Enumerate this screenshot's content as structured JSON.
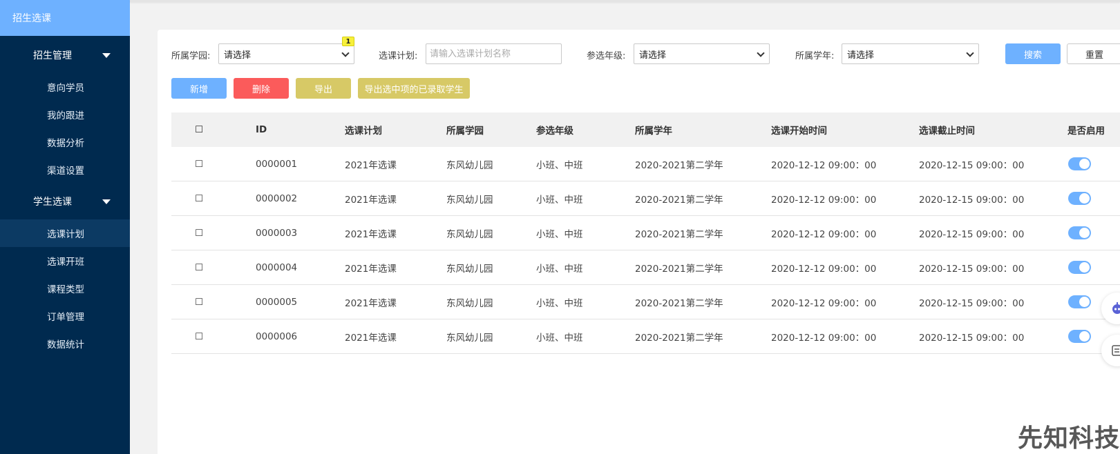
{
  "sidebar": {
    "brand": "招生选课",
    "groups": [
      {
        "title": "招生管理",
        "items": [
          "意向学员",
          "我的跟进",
          "数据分析",
          "渠道设置"
        ]
      },
      {
        "title": "学生选课",
        "items": [
          "选课计划",
          "选课开班",
          "课程类型",
          "订单管理",
          "数据统计"
        ]
      }
    ],
    "active_item": "选课计划"
  },
  "filters": {
    "campus_label": "所属学园:",
    "campus_value": "请选择",
    "badge": "1",
    "plan_label": "选课计划:",
    "plan_placeholder": "请输入选课计划名称",
    "grade_label": "参选年级:",
    "grade_value": "请选择",
    "year_label": "所属学年:",
    "year_value": "请选择",
    "search": "搜索",
    "reset": "重置"
  },
  "actions": {
    "add": "新增",
    "delete": "删除",
    "export": "导出",
    "export_selected": "导出选中项的已录取学生"
  },
  "colors": {
    "sidebar_bg": "#002a4f",
    "brand_bg": "#6eb1ff",
    "primary": "#6eb1ff",
    "danger": "#fb5b5b",
    "warning": "#d7c966"
  },
  "table": {
    "headers": [
      "☐",
      "ID",
      "选课计划",
      "所属学园",
      "参选年级",
      "所属学年",
      "选课开始时间",
      "选课截止时间",
      "是否启用"
    ],
    "rows": [
      {
        "id": "0000001",
        "plan": "2021年选课",
        "campus": "东风幼儿园",
        "grade": "小班、中班",
        "year": "2020-2021第二学年",
        "start": "2020-12-12 09:00：00",
        "end": "2020-12-15 09:00：00",
        "enabled": true
      },
      {
        "id": "0000002",
        "plan": "2021年选课",
        "campus": "东风幼儿园",
        "grade": "小班、中班",
        "year": "2020-2021第二学年",
        "start": "2020-12-12 09:00：00",
        "end": "2020-12-15 09:00：00",
        "enabled": true
      },
      {
        "id": "0000003",
        "plan": "2021年选课",
        "campus": "东风幼儿园",
        "grade": "小班、中班",
        "year": "2020-2021第二学年",
        "start": "2020-12-12 09:00：00",
        "end": "2020-12-15 09:00：00",
        "enabled": true
      },
      {
        "id": "0000004",
        "plan": "2021年选课",
        "campus": "东风幼儿园",
        "grade": "小班、中班",
        "year": "2020-2021第二学年",
        "start": "2020-12-12 09:00：00",
        "end": "2020-12-15 09:00：00",
        "enabled": true
      },
      {
        "id": "0000005",
        "plan": "2021年选课",
        "campus": "东风幼儿园",
        "grade": "小班、中班",
        "year": "2020-2021第二学年",
        "start": "2020-12-12 09:00：00",
        "end": "2020-12-15 09:00：00",
        "enabled": true
      },
      {
        "id": "0000006",
        "plan": "2021年选课",
        "campus": "东风幼儿园",
        "grade": "小班、中班",
        "year": "2020-2021第二学年",
        "start": "2020-12-12 09:00：00",
        "end": "2020-12-15 09:00：00",
        "enabled": true
      }
    ]
  },
  "watermark": "先知科技"
}
